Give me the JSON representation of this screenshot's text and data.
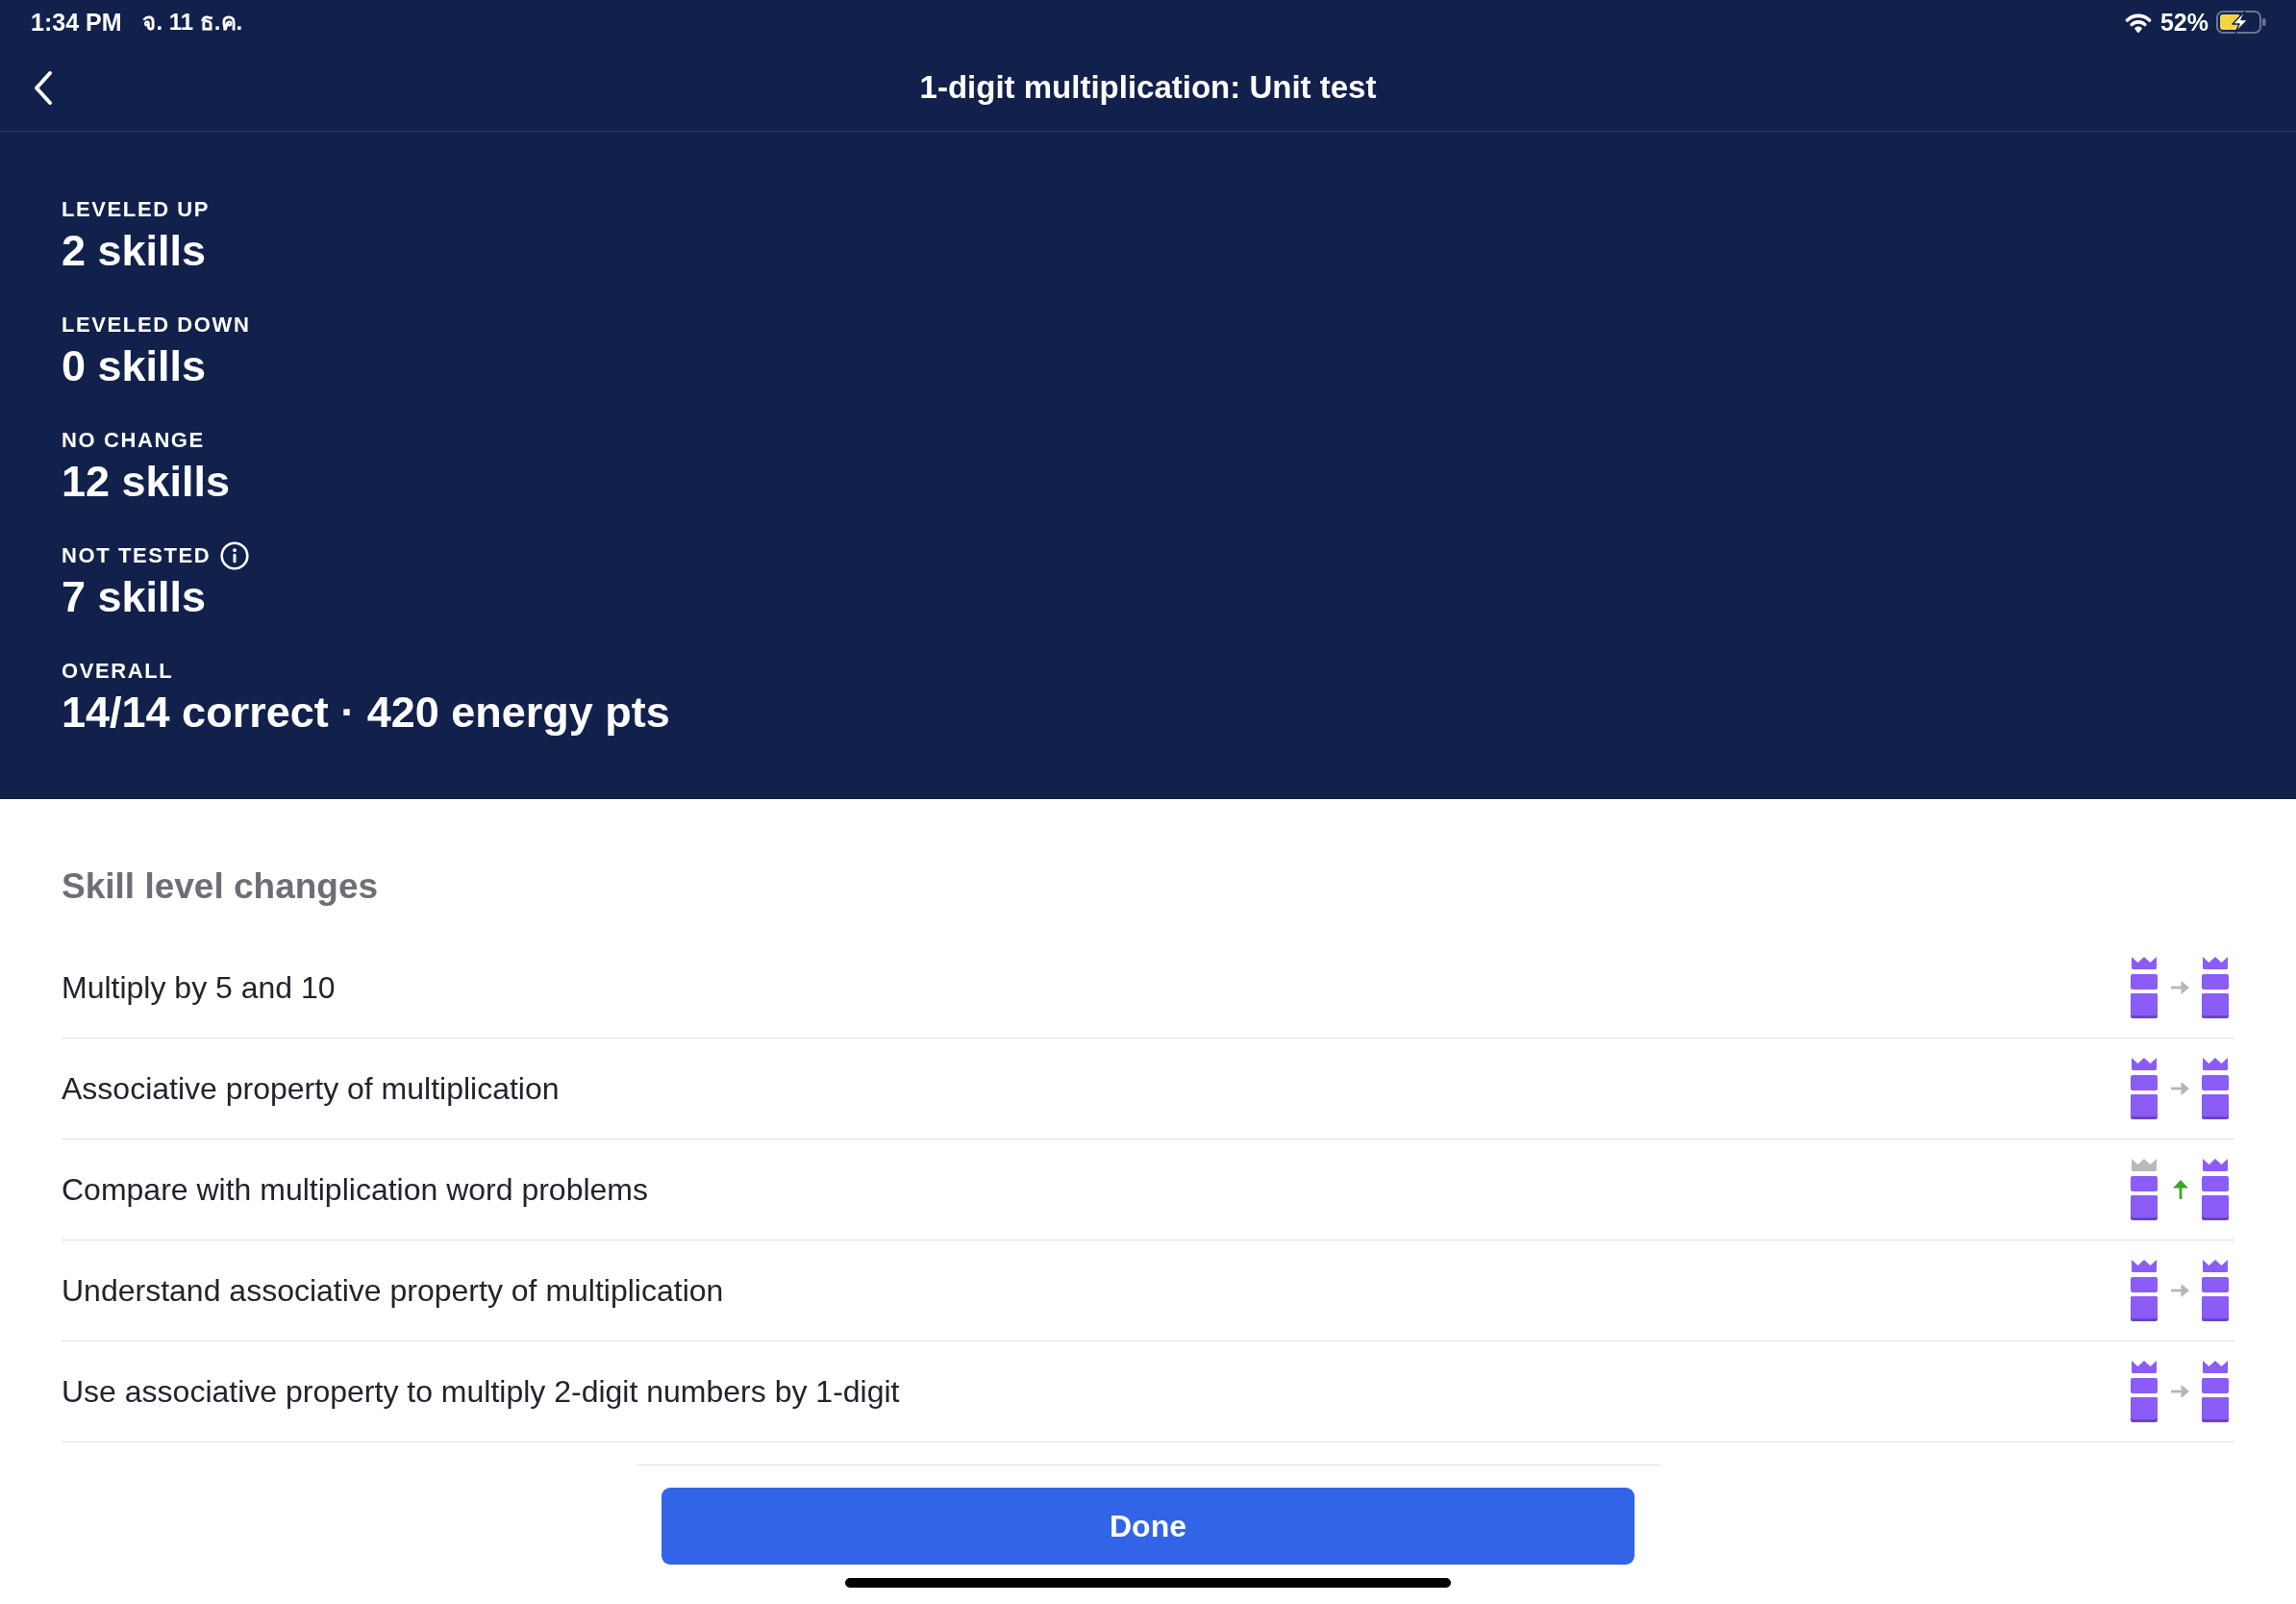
{
  "status_bar": {
    "time": "1:34 PM",
    "date": "จ. 11 ธ.ค.",
    "battery": "52%",
    "charging": true
  },
  "header": {
    "title": "1-digit multiplication: Unit test"
  },
  "summary": [
    {
      "label": "LEVELED UP",
      "value": "2 skills",
      "info": false
    },
    {
      "label": "LEVELED DOWN",
      "value": "0 skills",
      "info": false
    },
    {
      "label": "NO CHANGE",
      "value": "12 skills",
      "info": false
    },
    {
      "label": "NOT TESTED",
      "value": "7 skills",
      "info": true
    },
    {
      "label": "OVERALL",
      "value": "14/14 correct · 420 energy pts",
      "info": false
    }
  ],
  "skill_level_changes": {
    "heading": "Skill level changes",
    "skills": [
      {
        "name": "Multiply by 5 and 10",
        "kind": "same",
        "before_mastered": true,
        "after_mastered": true
      },
      {
        "name": "Associative property of multiplication",
        "kind": "same",
        "before_mastered": true,
        "after_mastered": true
      },
      {
        "name": "Compare with multiplication word problems",
        "kind": "up",
        "before_mastered": false,
        "after_mastered": true
      },
      {
        "name": "Understand associative property of multiplication",
        "kind": "same",
        "before_mastered": true,
        "after_mastered": true
      },
      {
        "name": "Use associative property to multiply 2-digit numbers by 1-digit",
        "kind": "same",
        "before_mastered": true,
        "after_mastered": true
      }
    ]
  },
  "footer": {
    "done_button": "Done"
  }
}
